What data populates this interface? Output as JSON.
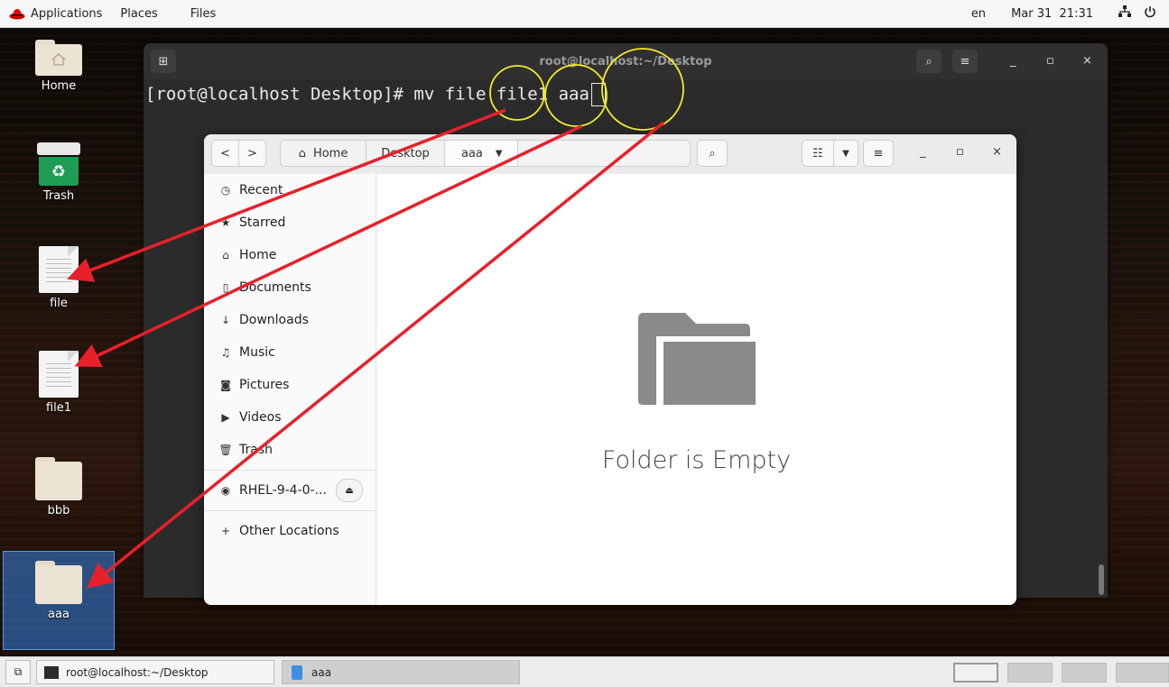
{
  "topbar": {
    "applications": "Applications",
    "places": "Places",
    "files": "Files",
    "lang": "en",
    "datetime": "Mar 31  21:31",
    "icons": [
      "redhat-logo-icon",
      "network-icon",
      "power-icon"
    ]
  },
  "desktop": {
    "icons": [
      {
        "label": "Home",
        "icon": "home-folder-icon"
      },
      {
        "label": "Trash",
        "icon": "trash-icon"
      },
      {
        "label": "file",
        "icon": "text-file-icon"
      },
      {
        "label": "file1",
        "icon": "text-file-icon"
      },
      {
        "label": "bbb",
        "icon": "folder-icon"
      },
      {
        "label": "aaa",
        "icon": "folder-icon",
        "selected": true
      }
    ]
  },
  "terminal": {
    "title": "root@localhost:~/Desktop",
    "prompt": "[root@localhost Desktop]# ",
    "command": "mv file file1 aaa"
  },
  "nautilus": {
    "breadcrumbs": [
      "Home",
      "Desktop",
      "aaa"
    ],
    "sidebar": [
      {
        "label": "Recent",
        "icon": "clock-icon",
        "glyph": "◷"
      },
      {
        "label": "Starred",
        "icon": "star-icon",
        "glyph": "★"
      },
      {
        "label": "Home",
        "icon": "home-icon",
        "glyph": "⌂"
      },
      {
        "label": "Documents",
        "icon": "document-icon",
        "glyph": "▯"
      },
      {
        "label": "Downloads",
        "icon": "download-icon",
        "glyph": "↓"
      },
      {
        "label": "Music",
        "icon": "music-icon",
        "glyph": "♫"
      },
      {
        "label": "Pictures",
        "icon": "camera-icon",
        "glyph": "◙"
      },
      {
        "label": "Videos",
        "icon": "video-icon",
        "glyph": "▶"
      },
      {
        "label": "Trash",
        "icon": "trash-icon",
        "glyph": "🗑"
      }
    ],
    "device": "RHEL-9-4-0-...",
    "other_locations": "Other Locations",
    "empty_text": "Folder is Empty"
  },
  "taskbar": {
    "items": [
      {
        "label": "root@localhost:~/Desktop",
        "icon": "terminal-icon"
      },
      {
        "label": "aaa",
        "icon": "file-manager-icon"
      }
    ],
    "workspaces": 4
  },
  "annotation": {
    "color": "#e8202a",
    "circle_color": "#f2ea2a"
  }
}
